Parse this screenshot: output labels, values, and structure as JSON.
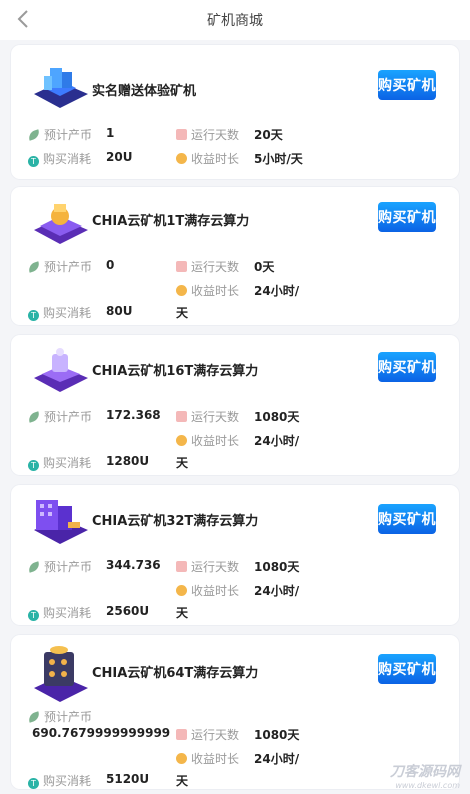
{
  "header": {
    "title": "矿机商城"
  },
  "labels": {
    "coin": "预计产币",
    "days": "运行天数",
    "cost": "购买消耗",
    "duration": "收益时长",
    "buy": "购买矿机"
  },
  "products": [
    {
      "name": "实名赠送体验矿机",
      "coin": "1",
      "days": "20天",
      "cost": "20U",
      "duration": "5小时/天"
    },
    {
      "name": "CHIA云矿机1T满存云算力",
      "coin": "0",
      "days": "0天",
      "cost": "80U",
      "duration_a": "24小时/",
      "duration_b": "天"
    },
    {
      "name": "CHIA云矿机16T满存云算力",
      "coin": "172.368",
      "days": "1080天",
      "cost": "1280U",
      "duration_a": "24小时/",
      "duration_b": "天"
    },
    {
      "name": "CHIA云矿机32T满存云算力",
      "coin": "344.736",
      "days": "1080天",
      "cost": "2560U",
      "duration_a": "24小时/",
      "duration_b": "天"
    },
    {
      "name": "CHIA云矿机64T满存云算力",
      "coin": "690.7679999999999",
      "days": "1080天",
      "cost": "5120U",
      "duration_a": "24小时/",
      "duration_b": "天"
    }
  ],
  "watermark": {
    "main": "刀客源码网",
    "sub": "www.dkewl.com"
  },
  "colors": {
    "buy_button": "#0b7ff0",
    "accent_purple": "#6b3fd6"
  }
}
